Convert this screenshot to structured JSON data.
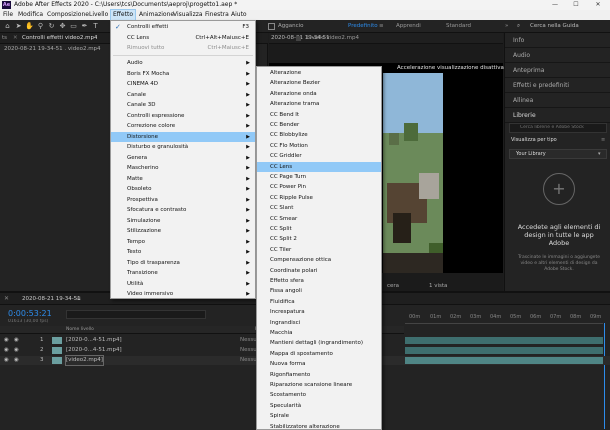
{
  "titlebar": {
    "title": "Adobe After Effects 2020 - C:\\Users\\tcs\\Documents\\aeproj\\progetto1.aep *",
    "minimize": "—",
    "maximize": "☐",
    "close": "✕",
    "app_icon": "Ae"
  },
  "menubar": [
    "File",
    "Modifica",
    "Composizione",
    "Livello",
    "Effetto",
    "Animazione",
    "Visualizza",
    "Finestra",
    "Aiuto"
  ],
  "toolbar": {
    "aggancio": "Aggancio",
    "workspace": [
      "Predefinito",
      "Apprendi",
      "Standard"
    ],
    "workspace_more": "»",
    "search_placeholder": "Cerca nella Guida"
  },
  "left_panel": {
    "tab": "Controlli effetti video2.mp4",
    "tab_prefix": "ts",
    "subheader": "2020-08-21 19-34-51 . video2.mp4",
    "menu_icon": "≡"
  },
  "viewer": {
    "tab_comp": "2020-08-21 19-34-51",
    "tab_layer": "Livello video2.mp4",
    "notice": "Accelerazione visualizzazione disattivata",
    "zoom": "1 vista",
    "camera": "cera"
  },
  "right_panel": {
    "items": [
      "Info",
      "Audio",
      "Anteprima",
      "Effetti e predefiniti",
      "Allinea",
      "Librerie"
    ],
    "library_search": "Cerca librerie e Adobe Stock",
    "view_by": "Visualizza per tipo",
    "your_library": "Your Library",
    "cta_title": "Accedete agli elementi di design in tutte le app Adobe",
    "cta_desc": "Trascinate le immagini o aggiungete video e altri elementi di design da Adobe Stock."
  },
  "effetto_menu": {
    "items": [
      {
        "label": "Controlli effetti",
        "shortcut": "F3",
        "checked": true
      },
      {
        "label": "CC Lens",
        "shortcut": "Ctrl+Alt+Maiusc+E"
      },
      {
        "label": "Rimuovi tutto",
        "shortcut": "Ctrl+Maiusc+E",
        "disabled": true
      },
      {
        "sep": true
      },
      {
        "label": "Audio",
        "arrow": true
      },
      {
        "label": "Boris FX Mocha",
        "arrow": true
      },
      {
        "label": "CINEMA 4D",
        "arrow": true
      },
      {
        "label": "Canale",
        "arrow": true
      },
      {
        "label": "Canale 3D",
        "arrow": true
      },
      {
        "label": "Controlli espressione",
        "arrow": true
      },
      {
        "label": "Correzione colore",
        "arrow": true
      },
      {
        "label": "Distorsione",
        "arrow": true,
        "highlight": true
      },
      {
        "label": "Disturbo e granulosità",
        "arrow": true
      },
      {
        "label": "Genera",
        "arrow": true
      },
      {
        "label": "Mascherino",
        "arrow": true
      },
      {
        "label": "Matte",
        "arrow": true
      },
      {
        "label": "Obsoleto",
        "arrow": true
      },
      {
        "label": "Prospettiva",
        "arrow": true
      },
      {
        "label": "Sfocatura e contrasto",
        "arrow": true
      },
      {
        "label": "Simulazione",
        "arrow": true
      },
      {
        "label": "Stilizzazione",
        "arrow": true
      },
      {
        "label": "Tempo",
        "arrow": true
      },
      {
        "label": "Testo",
        "arrow": true
      },
      {
        "label": "Tipo di trasparenza",
        "arrow": true
      },
      {
        "label": "Transizione",
        "arrow": true
      },
      {
        "label": "Utilità",
        "arrow": true
      },
      {
        "label": "Video immersivo",
        "arrow": true
      }
    ]
  },
  "distorsione_submenu": {
    "items": [
      "Alterazione",
      "Alterazione Bezier",
      "Alterazione onda",
      "Alterazione trama",
      "CC Bend It",
      "CC Bender",
      "CC Blobbylize",
      "CC Flo Motion",
      "CC Griddler",
      "CC Lens",
      "CC Page Turn",
      "CC Power Pin",
      "CC Ripple Pulse",
      "CC Slant",
      "CC Smear",
      "CC Split",
      "CC Split 2",
      "CC Tiler",
      "Compensazione ottica",
      "Coordinate polari",
      "Effetto sfera",
      "Fissa angoli",
      "Fluidifica",
      "Increspatura",
      "Ingrandisci",
      "Macchia",
      "Mantieni dettagli (ingrandimento)",
      "Mappa di spostamento",
      "Nuova forma",
      "Rigonfiamento",
      "Riparazione scansione lineare",
      "Scostamento",
      "Specularità",
      "Spirale",
      "Stabilizzatore alterazione"
    ],
    "highlight_index": 9
  },
  "timeline": {
    "tab": "2020-08-21 19-34-51",
    "timecode": "0:00:53:21",
    "frame_info": "01613 (30,00 fps)",
    "search_placeholder": "",
    "col_name": "Nome livello",
    "col_parent": "Principale e colleg.",
    "ruler": [
      "00m",
      "01m",
      "02m",
      "03m",
      "04m",
      "05m",
      "06m",
      "07m",
      "08m",
      "09m"
    ],
    "layers": [
      {
        "num": "1",
        "name": "[2020-0...4-51.mp4]",
        "parent": "Nessuno"
      },
      {
        "num": "2",
        "name": "[2020-0...4-51.mp4]",
        "parent": "Nessuno"
      },
      {
        "num": "3",
        "name": "[video2.mp4]",
        "parent": "Nessuno"
      }
    ]
  }
}
